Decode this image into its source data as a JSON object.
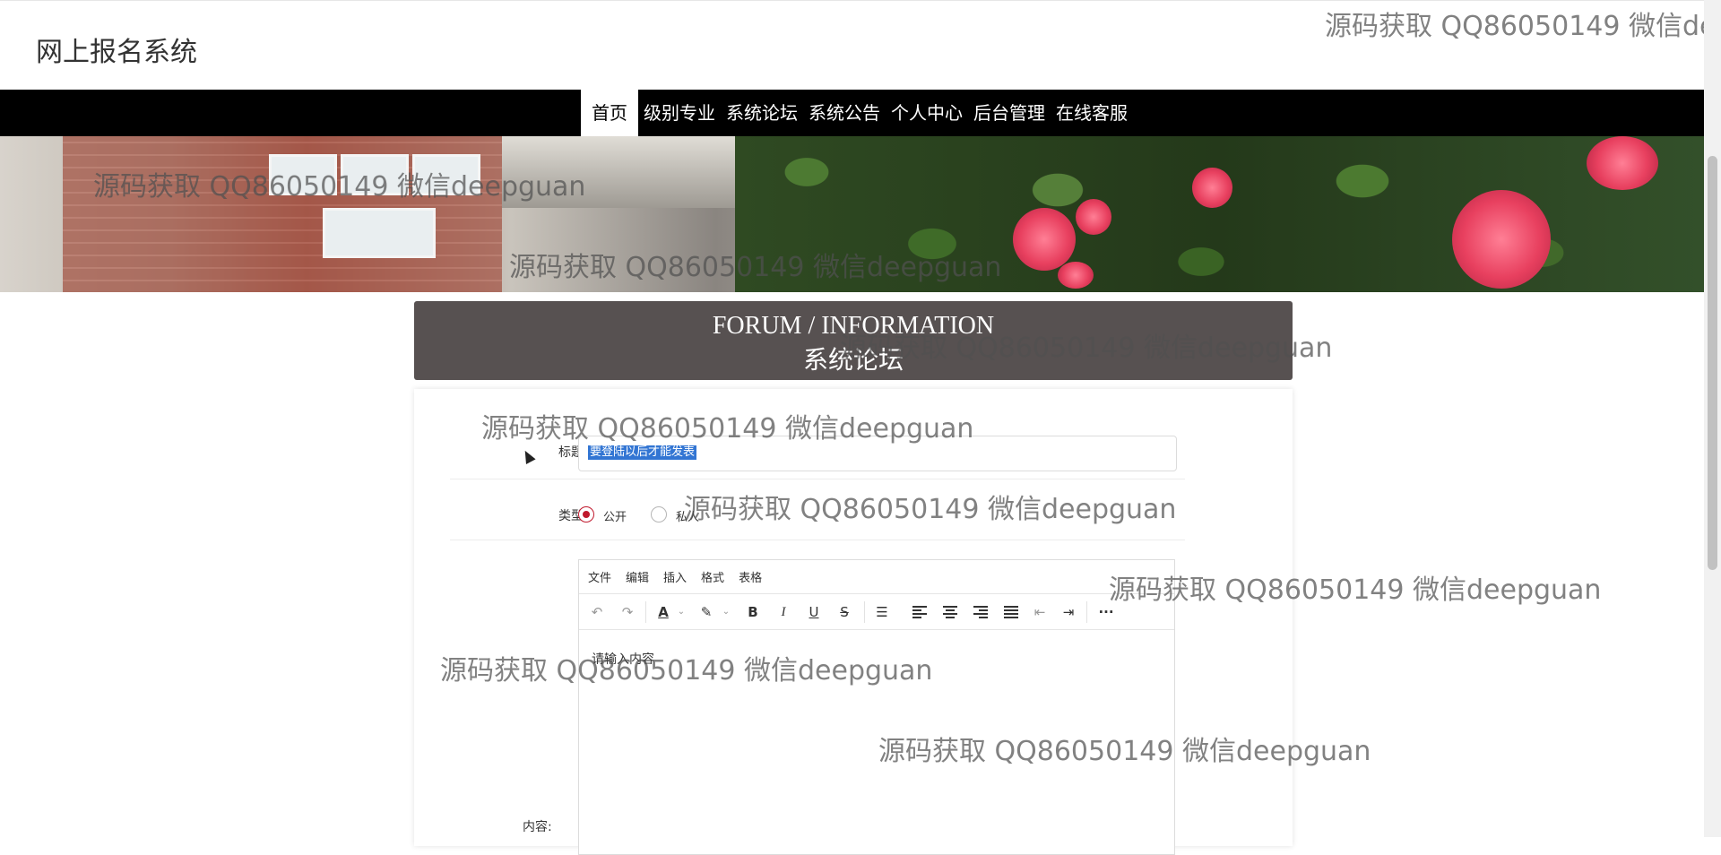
{
  "site": {
    "title": "网上报名系统"
  },
  "nav": {
    "items": [
      "首页",
      "级别专业",
      "系统论坛",
      "系统公告",
      "个人中心",
      "后台管理",
      "在线客服"
    ],
    "active": "首页"
  },
  "section": {
    "title_en": "FORUM / INFORMATION",
    "title_cn": "系统论坛"
  },
  "form": {
    "title_label": "标题:",
    "title_value": "要登陆以后才能发表",
    "type_label": "类型:",
    "type_options": [
      "公开",
      "私人"
    ],
    "type_selected": "公开",
    "content_label": "内容:",
    "editor": {
      "menus": [
        "文件",
        "编辑",
        "插入",
        "格式",
        "表格"
      ],
      "toolbar_icons": [
        "undo-icon",
        "redo-icon",
        "font-color-icon",
        "highlight-icon",
        "bold-icon",
        "italic-icon",
        "underline-icon",
        "strikethrough-icon",
        "list-icon",
        "align-left-icon",
        "align-center-icon",
        "align-right-icon",
        "align-justify-icon",
        "outdent-icon",
        "indent-icon",
        "more-icon"
      ],
      "content": "请输入内容"
    }
  },
  "watermark": "源码获取 QQ86050149 微信deepguan",
  "watermark_partial": "源码获取 QQ86050149 微信dee",
  "colors": {
    "nav_bg": "#000000",
    "section_bg": "#575151",
    "radio_active": "#c0192d",
    "selection": "#3275d3"
  }
}
